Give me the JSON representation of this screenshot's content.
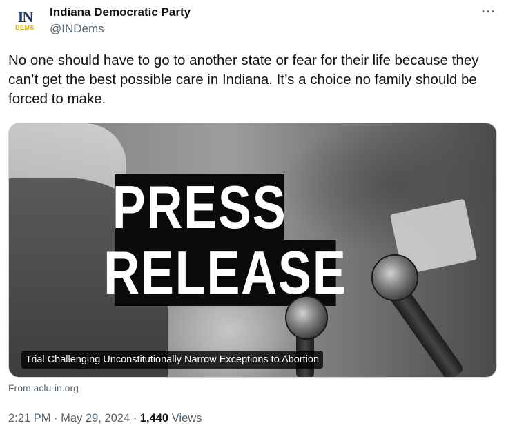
{
  "account": {
    "avatar_mark": "IN",
    "avatar_sub": "DEMS",
    "display_name": "Indiana Democratic Party",
    "handle": "@INDems"
  },
  "tweet": {
    "text": "No one should have to go to another state or fear for their life because they can’t get the best possible care in Indiana. It’s a choice no family should be forced to make."
  },
  "media": {
    "headline_line1": "PRESS",
    "headline_line2": "RELEASE",
    "caption": "Trial Challenging Unconstitutionally Narrow Exceptions to Abortion"
  },
  "link_card": {
    "source": "From aclu-in.org"
  },
  "meta": {
    "time": "2:21 PM",
    "separator": "·",
    "date": "May 29, 2024",
    "views_count": "1,440",
    "views_label": "Views"
  },
  "icons": {
    "more": "more-horizontal-icon"
  },
  "colors": {
    "text": "#0f1419",
    "secondary": "#536471",
    "border": "#cfd9de",
    "avatar_navy": "#1b3a6b",
    "avatar_gold": "#e5b300"
  }
}
